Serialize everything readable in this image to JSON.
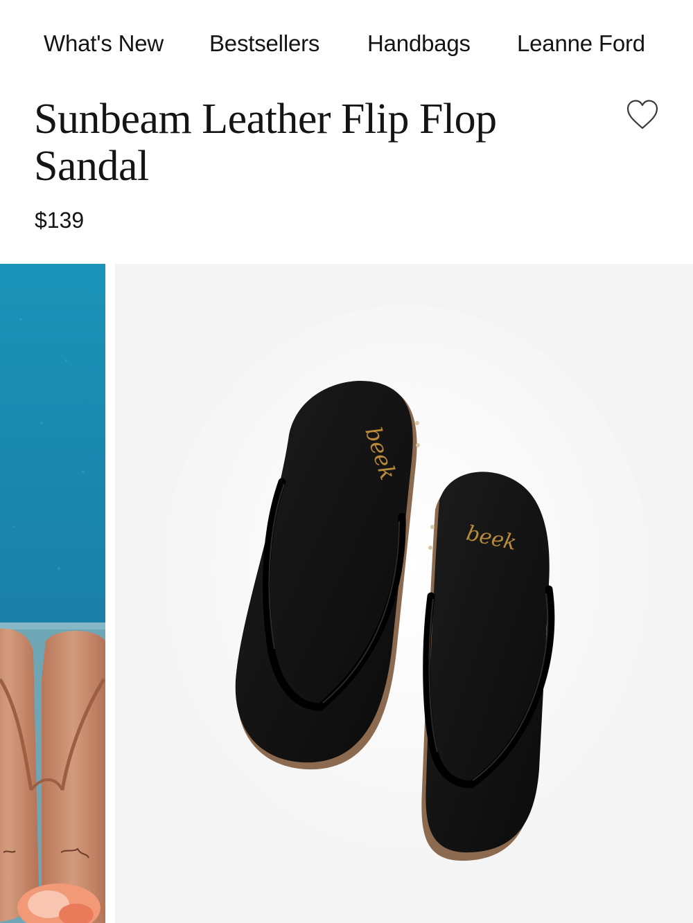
{
  "nav": {
    "items": [
      {
        "label": "What's New"
      },
      {
        "label": "Bestsellers"
      },
      {
        "label": "Handbags"
      },
      {
        "label": "Leanne Ford"
      }
    ]
  },
  "product": {
    "title": "Sunbeam Leather Flip Flop Sandal",
    "price": "$139",
    "favorite_icon": "heart-outline-icon",
    "brand_mark": "beek"
  },
  "gallery": {
    "thumbnail_colors": {
      "pool": "#1b8fb4",
      "deck": "#6fa6b6",
      "sandal": "#c98a6a"
    },
    "main_background": "#f4f4f4",
    "sandal_color": "#111111",
    "logo_color": "#b88a3a"
  }
}
